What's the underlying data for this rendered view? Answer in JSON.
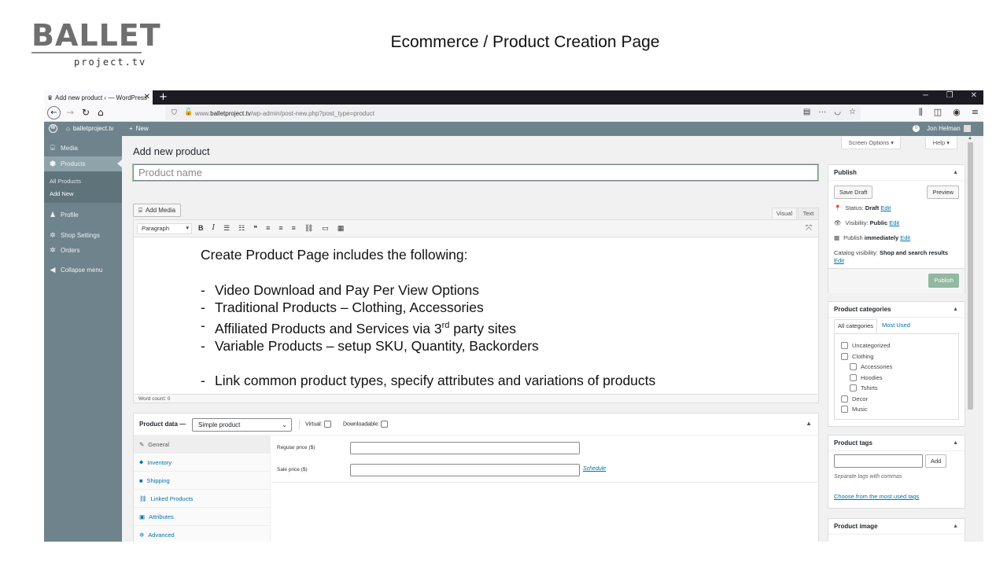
{
  "slide": {
    "logo_word": "BALLET",
    "logo_sub": "project.tv",
    "title": "Ecommerce  / Product Creation Page"
  },
  "browser": {
    "tab_title": "Add new product ‹ — WordPress",
    "new_tab": "+",
    "url_host": "www.balletproject.tv",
    "url_path": "/wp-admin/post-new.php?post_type=product",
    "url_display_prefix": "www.",
    "url_display_host": "balletproject.tv",
    "win_min": "−",
    "win_restore": "❐",
    "win_close": "✕"
  },
  "adminbar": {
    "site_name": "balletproject.tv",
    "new_label": "New",
    "notification_count": "0",
    "user": "Jon Helman"
  },
  "sidebar": {
    "media": "Media",
    "products": "Products",
    "all_products": "All Products",
    "add_new": "Add New",
    "profile": "Profile",
    "shop_settings": "Shop Settings",
    "orders": "Orders",
    "collapse": "Collapse menu"
  },
  "content": {
    "screen_options": "Screen Options ▾",
    "help": "Help ▾",
    "heading": "Add new product",
    "title_placeholder": "Product name",
    "add_media": "Add Media",
    "tab_visual": "Visual",
    "tab_text": "Text",
    "format_select": "Paragraph",
    "editor_intro": "Create Product Page includes the following:",
    "editor_items": [
      "Video Download and Pay Per View Options",
      "Traditional Products – Clothing, Accessories",
      "Affiliated Products and Services via 3",
      "Variable Products – setup SKU, Quantity, Backorders"
    ],
    "editor_sup": "rd",
    "editor_item3_tail": " party sites",
    "editor_last": "Link common product types, specify attributes and variations of products",
    "dash": "-",
    "word_count": "Word count: 0"
  },
  "product_data": {
    "label": "Product data —",
    "type_select": "Simple product",
    "virtual": "Virtual:",
    "downloadable": "Downloadable:",
    "tabs": [
      "General",
      "Inventory",
      "Shipping",
      "Linked Products",
      "Attributes",
      "Advanced"
    ],
    "regular_price_label": "Regular price ($)",
    "sale_price_label": "Sale price ($)",
    "schedule": "Schedule"
  },
  "publish": {
    "title": "Publish",
    "save_draft": "Save Draft",
    "preview": "Preview",
    "status_label": "Status:",
    "status_value": "Draft",
    "visibility_label": "Visibility:",
    "visibility_value": "Public",
    "publish_label": "Publish",
    "publish_value": "immediately",
    "catalog_label": "Catalog visibility:",
    "catalog_value": "Shop and search results",
    "edit": "Edit",
    "publish_button": "Publish"
  },
  "categories": {
    "title": "Product categories",
    "tab_all": "All categories",
    "tab_most_used": "Most Used",
    "items": [
      "Uncategorized",
      "Clothing",
      "Accessories",
      "Hoodies",
      "Tshirts",
      "Decor",
      "Music"
    ]
  },
  "tags": {
    "title": "Product tags",
    "add": "Add",
    "hint": "Separate tags with commas",
    "choose": "Choose from the most used tags"
  },
  "product_image": {
    "title": "Product image"
  },
  "colors": {
    "admin_sidebar": "#6e838c",
    "tabbar": "#1c1b22",
    "link": "#0073aa",
    "publish_btn": "#93b8a0"
  }
}
